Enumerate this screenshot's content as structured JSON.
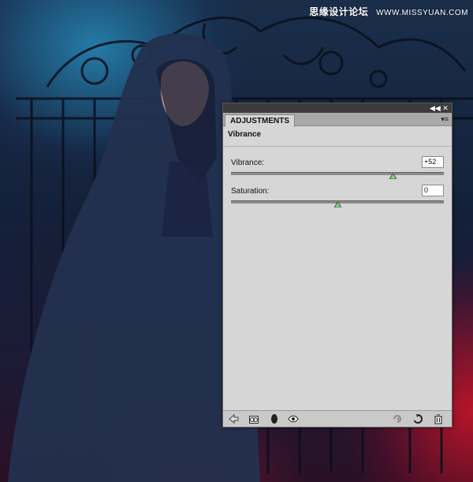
{
  "watermark": {
    "chinese_text": "思缘设计论坛",
    "url_text": "WWW.MISSYUAN.COM"
  },
  "panel": {
    "tab_label": "ADJUSTMENTS",
    "collapse_icon": "double-chevron-left-icon",
    "close_icon": "close-icon",
    "menu_icon": "panel-menu-icon",
    "section_title": "Vibrance",
    "controls": [
      {
        "label": "Vibrance:",
        "value": "+52",
        "slider_fraction": 0.76
      },
      {
        "label": "Saturation:",
        "value": "0",
        "slider_fraction": 0.5
      }
    ],
    "bottom_icons": [
      "back-arrow-icon",
      "clip-to-layer-icon",
      "mask-toggle-icon",
      "eye-icon",
      "view-previous-state-icon",
      "reset-icon",
      "trash-icon"
    ]
  },
  "colors": {
    "panel_bg": "#d6d6d6",
    "topbar": "#3c3c3c",
    "tabbar": "#a9a9a9",
    "slider_thumb": "#7fbf7f",
    "accent_blue": "#2a8fc7",
    "accent_red": "#d2142a"
  }
}
